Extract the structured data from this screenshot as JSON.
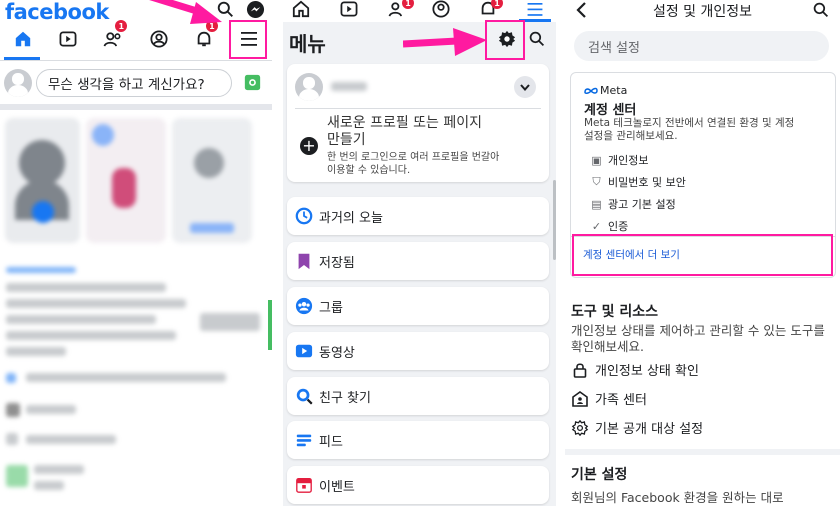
{
  "panel1": {
    "logo": "facebook",
    "compose_placeholder": "무슨 생각을 하고 계신가요?",
    "friend_badge": "1",
    "notif_badge": "1"
  },
  "panel2": {
    "title": "메뉴",
    "friend_badge": "1",
    "notif_badge": "1",
    "create_profile_title_line1": "새로운 프로필 또는 페이지",
    "create_profile_title_line2": "만들기",
    "create_profile_desc_line1": "한 번의 로그인으로 여러 프로필을 번갈아",
    "create_profile_desc_line2": "이용할 수 있습니다.",
    "menu_items": [
      {
        "label": "과거의 오늘",
        "icon": "memories-icon",
        "color": "#1877f2"
      },
      {
        "label": "저장됨",
        "icon": "saved-icon",
        "color": "#8e44ad"
      },
      {
        "label": "그룹",
        "icon": "groups-icon",
        "color": "#1877f2"
      },
      {
        "label": "동영상",
        "icon": "video-icon",
        "color": "#1877f2"
      },
      {
        "label": "친구 찾기",
        "icon": "find-friends-icon",
        "color": "#1877f2"
      },
      {
        "label": "피드",
        "icon": "feeds-icon",
        "color": "#1877f2"
      },
      {
        "label": "이벤트",
        "icon": "events-icon",
        "color": "#e41e3f"
      }
    ]
  },
  "panel3": {
    "title": "설정 및 개인정보",
    "search_placeholder": "검색 설정",
    "meta_brand": "Meta",
    "account_center_title": "계정 센터",
    "account_center_desc_line1": "Meta 테크놀로지 전반에서 연결된 환경 및 계정",
    "account_center_desc_line2": "설정을 관리해보세요.",
    "account_items": [
      {
        "label": "개인정보",
        "icon": "id-card-icon"
      },
      {
        "label": "비밀번호 및 보안",
        "icon": "shield-icon"
      },
      {
        "label": "광고 기본 설정",
        "icon": "ad-icon"
      },
      {
        "label": "인증",
        "icon": "check-circle-icon"
      }
    ],
    "account_center_link": "계정 센터에서 더 보기",
    "tools_title": "도구 및 리소스",
    "tools_desc_line1": "개인정보 상태를 제어하고 관리할 수 있는 도구를",
    "tools_desc_line2": "확인해보세요.",
    "tools_items": [
      {
        "label": "개인정보 상태 확인",
        "icon": "lock-icon"
      },
      {
        "label": "가족 센터",
        "icon": "family-icon"
      },
      {
        "label": "기본 공개 대상 설정",
        "icon": "gear-icon"
      }
    ],
    "basic_title": "기본 설정",
    "basic_desc_line1": "회원님의 Facebook 환경을 원하는 대로"
  },
  "colors": {
    "brand": "#1877f2",
    "highlight": "#ff1aa0"
  }
}
